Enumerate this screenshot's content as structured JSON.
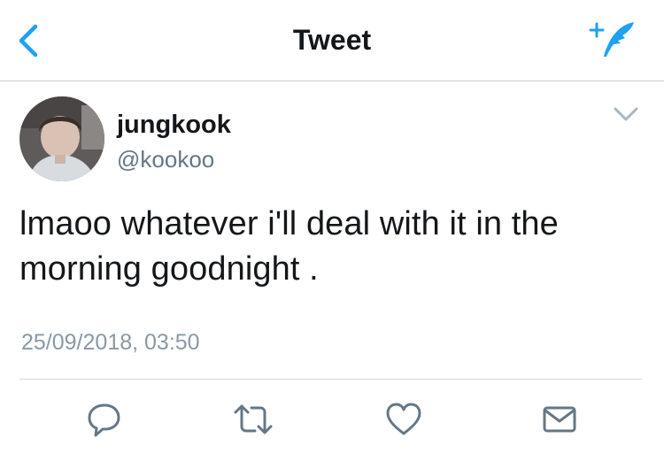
{
  "header": {
    "title": "Tweet",
    "back_icon": "chevron-left-icon",
    "compose_icon": "compose-tweet-icon",
    "accent_color": "#1da1f2"
  },
  "tweet": {
    "author": {
      "display_name": "jungkook",
      "handle": "@kookoo"
    },
    "text_line1": "lmaoo whatever i'll deal with it in the",
    "text_line2": "morning goodnight .",
    "timestamp": "25/09/2018, 03:50",
    "menu_icon": "chevron-down-icon"
  },
  "actions": [
    {
      "icon": "reply-icon"
    },
    {
      "icon": "retweet-icon"
    },
    {
      "icon": "like-icon"
    },
    {
      "icon": "direct-message-icon"
    }
  ],
  "colors": {
    "text": "#14171a",
    "secondary": "#657786",
    "muted": "#8899a6",
    "icon": "#657786",
    "divider": "#d4d8dc"
  }
}
